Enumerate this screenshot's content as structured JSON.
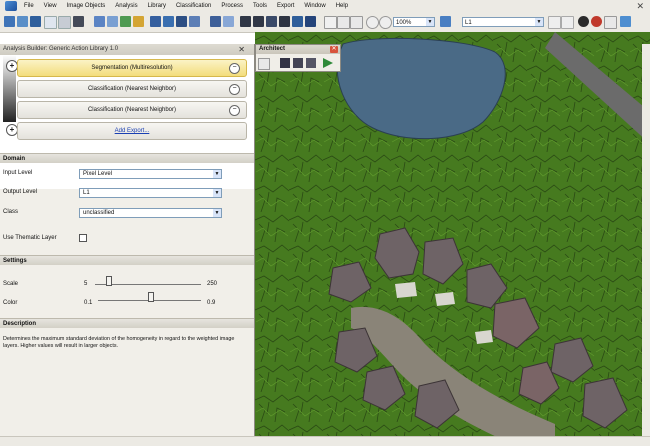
{
  "menubar": {
    "items": [
      "File",
      "View",
      "Image Objects",
      "Analysis",
      "Library",
      "Classification",
      "Process",
      "Tools",
      "Export",
      "Window",
      "Help"
    ]
  },
  "toolbar": {
    "zoom_value": "100%",
    "level_value": "L1"
  },
  "panel": {
    "title": "Analysis Builder: Generic Action Library 1.0",
    "actions": [
      {
        "label": "Segmentation (Multiresolution)"
      },
      {
        "label": "Classification (Nearest Neighbor)"
      },
      {
        "label": "Classification (Nearest Neighbor)"
      }
    ],
    "add_export_label": "Add Export..."
  },
  "domain": {
    "heading": "Domain",
    "input_level_label": "Input Level",
    "input_level_value": "Pixel Level",
    "output_level_label": "Output Level",
    "output_level_value": "L1",
    "class_label": "Class",
    "class_value": "unclassified",
    "thematic_label": "Use Thematic Layer"
  },
  "settings": {
    "heading": "Settings",
    "scale_label": "Scale",
    "scale_min": "5",
    "scale_max": "250",
    "scale_value": 0.12,
    "color_label": "Color",
    "color_min": "0.1",
    "color_max": "0.9",
    "color_value": 0.5
  },
  "description": {
    "heading": "Description",
    "text": "Determines the maximum standard deviation of the homogeneity in regard to the weighted image layers. Higher values will result in larger objects."
  },
  "architect": {
    "title": "Architect"
  },
  "colors": {
    "vegetation": "#4a7a22",
    "water": "#4a6a86",
    "rooftop": "#6e6366",
    "pavement": "#8a8478",
    "highlight": "#f6e18a"
  }
}
